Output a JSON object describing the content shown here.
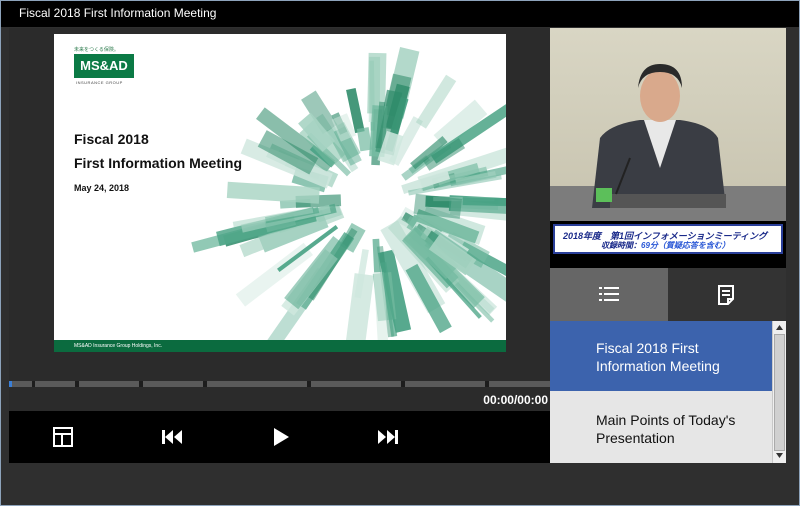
{
  "window": {
    "title": "Fiscal 2018 First Information Meeting"
  },
  "slide": {
    "tagline": "未来をつくる保険。",
    "logo": "MS&AD",
    "logo_sub": "INSURANCE GROUP",
    "title_line1": "Fiscal 2018",
    "title_line2": "First Information Meeting",
    "date": "May 24, 2018",
    "footer": "MS&AD Insurance Group Holdings, Inc."
  },
  "player": {
    "time": "00:00/00:00",
    "progress": 0.0,
    "controls": [
      "layout-icon",
      "skip-back-icon",
      "play-icon",
      "skip-forward-icon"
    ]
  },
  "video": {
    "caption_line1": "2018年度　第1回インフォメーションミーティング",
    "caption_label": "収録時間：",
    "caption_value": "69分（質疑応答を含む）"
  },
  "tabs": [
    {
      "icon": "list-icon",
      "active": true
    },
    {
      "icon": "notes-icon",
      "active": false
    }
  ],
  "chapters": [
    {
      "label": "Fiscal 2018 First Information Meeting",
      "active": true
    },
    {
      "label": "Main Points of Today's Presentation",
      "active": false
    }
  ],
  "colors": {
    "accent": "#3c63ad",
    "brand": "#0b7a45",
    "caption": "#1a2a8a"
  }
}
